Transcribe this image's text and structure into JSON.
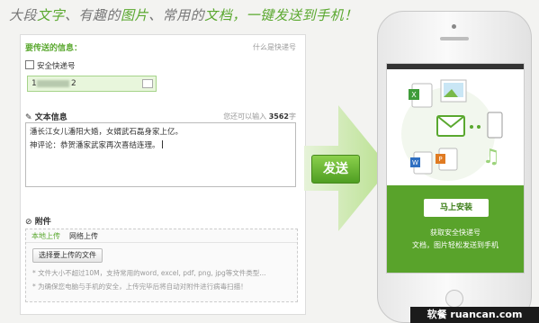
{
  "header": {
    "slogan_part1": "大段",
    "slogan_word1": "文字",
    "slogan_part2": "、有趣的",
    "slogan_word2": "图片",
    "slogan_part3": "、常用的",
    "slogan_word3": "文档",
    "slogan_part4": "，一键发送到手机！"
  },
  "form": {
    "title": "要传送的信息：",
    "help_link": "什么是快递号",
    "secure_checkbox_label": "安全快递号",
    "phone_value_prefix": "1",
    "phone_value_suffix": "2",
    "text_section_title": "文本信息",
    "char_limit_prefix": "您还可以输入",
    "char_limit_count": "3562",
    "char_limit_suffix": "字",
    "text_line1": "潘长江女儿潘阳大婚，女婿武石磊身家上亿。",
    "text_line2": "神评论：恭贺潘家武家再次喜结连理。",
    "attach_title": "附件",
    "tab_local": "本地上传",
    "tab_web": "网络上传",
    "choose_button": "选择要上传的文件",
    "tip1": "* 文件大小不超过10M，支持常用的word, excel, pdf, png, jpg等文件类型...",
    "tip2": "* 为确保您电脑与手机的安全，上传完毕后将自动对附件进行病毒扫描！"
  },
  "send_button": "发送",
  "phone": {
    "install_button": "马上安装",
    "line1": "获取安全快递号",
    "line2": "文档，图片轻松发送到手机"
  },
  "watermark": "软餐 ruancan.com",
  "colors": {
    "accent_green": "#5aa82f",
    "screen_green": "#59a32b",
    "icon_excel": "#3f9c3a",
    "icon_word": "#2f6fc1",
    "icon_ppt": "#e07b22"
  }
}
